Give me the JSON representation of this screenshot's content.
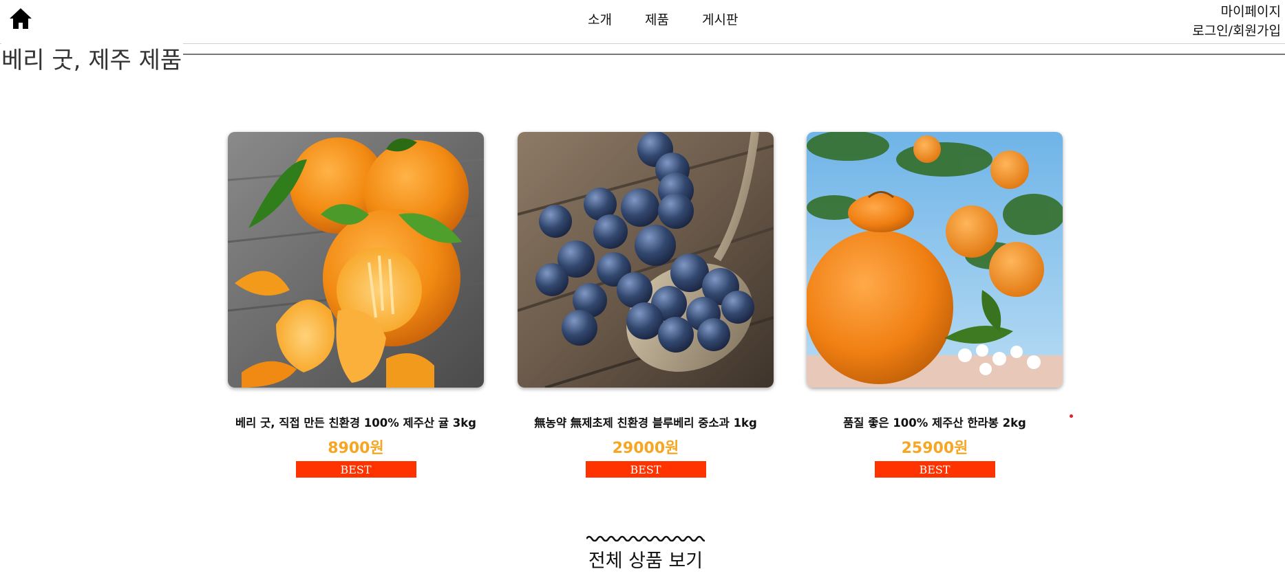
{
  "header": {
    "home_icon": "home-icon",
    "nav": [
      {
        "label": "소개"
      },
      {
        "label": "제품"
      },
      {
        "label": "게시판"
      }
    ],
    "mypage_label": "마이페이지",
    "login_label": "로그인/회원가입"
  },
  "section": {
    "title": "베리 굿, 제주 제품"
  },
  "products": [
    {
      "name": "베리 굿, 직접 만든 친환경 100% 제주산 귤 3kg",
      "price": "8900원",
      "badge": "BEST",
      "image": "tangerines-photo"
    },
    {
      "name": "無농약 無제초제 친환경 블루베리 중소과 1kg",
      "price": "29000원",
      "badge": "BEST",
      "image": "blueberries-photo"
    },
    {
      "name": "품질 좋은 100% 제주산 한라봉 2kg",
      "price": "25900원",
      "badge": "BEST",
      "image": "hallabong-photo"
    }
  ],
  "view_all": {
    "label": "전체 상품 보기"
  },
  "colors": {
    "price": "#f5a623",
    "badge_bg": "#ff3300",
    "dot": "#e0202a"
  }
}
